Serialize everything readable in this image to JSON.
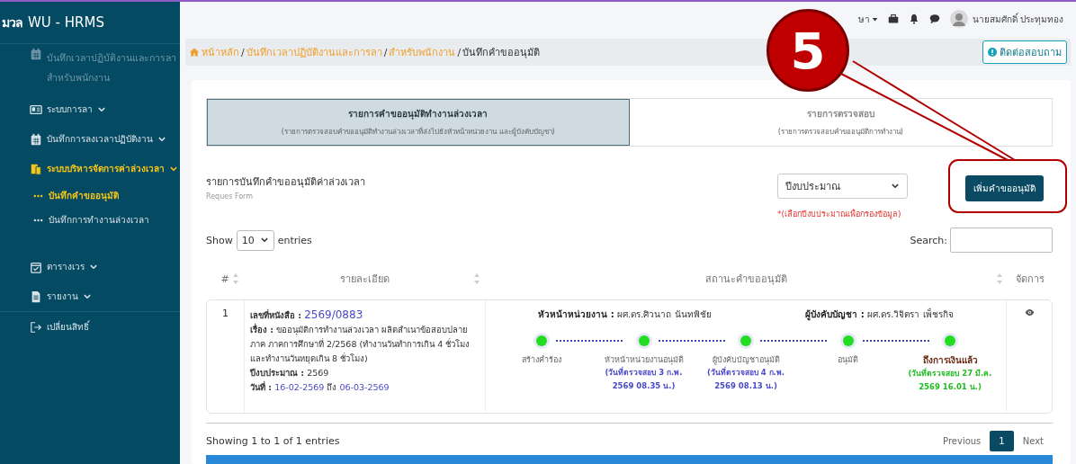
{
  "brand": {
    "logo": "มวล",
    "title": "WU - HRMS"
  },
  "sidebar": {
    "items": [
      {
        "label": "บันทึกเวลาปฏิบัติงานและการลา สำหรับพนักงาน",
        "kind": "header",
        "active": false
      },
      {
        "label": "ระบบการลา",
        "kind": "menu",
        "active": false
      },
      {
        "label": "บันทึกการลงเวลาปฏิบัติงาน",
        "kind": "menu",
        "active": false
      },
      {
        "label": "ระบบบริหารจัดการค่าล่วงเวลา",
        "kind": "menu",
        "active": true,
        "children": [
          {
            "label": "บันทึกคำขออนุมัติ",
            "selected": true
          },
          {
            "label": "บันทึกการทำงานล่วงเวลา",
            "selected": false
          }
        ]
      },
      {
        "label": "ตารางเวร",
        "kind": "menu",
        "active": false
      },
      {
        "label": "รายงาน",
        "kind": "menu",
        "active": false
      },
      {
        "label": "เปลี่ยนสิทธิ์",
        "kind": "link",
        "active": false
      }
    ]
  },
  "topbar": {
    "language": "ษา",
    "user": "นายสมศักดิ์ ประทุมทอง"
  },
  "breadcrumb_separator": "/",
  "breadcrumb": [
    "หน้าหลัก",
    "บันทึกเวลาปฏิบัติงานและการลา",
    "สำหรับพนักงาน",
    "บันทึกคำขออนุมัติ"
  ],
  "contact_button": "ติดต่อสอบถาม",
  "tabs": [
    {
      "title": "รายการคำขออนุมัติทำงานล่วงเวลา",
      "subtitle": "(รายการตรวจสอบคำขออนุมัติทำงานล่วงเวลาที่ส่งไปยังหัวหน้าหน่วยงาน และผู้บังคับบัญชา)",
      "selected": true
    },
    {
      "title": "รายการตรวจสอบ",
      "subtitle": "(รายการตรวจสอบคำขออนุมัติการทำงาน)",
      "selected": false
    }
  ],
  "list_header": {
    "title": "รายการบันทึกคำขออนุมัติค่าล่วงเวลา",
    "subtitle": "Reques Form"
  },
  "budget_select": {
    "value": "ปีงบประมาณ",
    "hint": "*(เลือกปีงบประมาณเพื่อกรองข้อมูล)"
  },
  "add_button": "เพิ่มคำขออนุมัติ",
  "length": {
    "show": "Show",
    "value": "10",
    "entries": "entries"
  },
  "search": {
    "label": "Search:"
  },
  "table": {
    "columns": [
      "#",
      "รายละเอียด",
      "สถานะคำขออนุมัติ",
      "จัดการ"
    ],
    "rows": [
      {
        "index": "1",
        "doc_no": {
          "label": "เลขที่หนังสือ :",
          "value": "2569/0883"
        },
        "subject": {
          "label": "เรื่อง :",
          "value": "ขออนุมัติการทำงานล่วงเวลา ผลิตสำเนาข้อสอบปลายภาค ภาคการศึกษาที่ 2/2568 (ทำงานวันทำการเกิน 4 ชั่วโมง และทำงานวันหยุดเกิน 8 ชั่วโมง)"
        },
        "budget_year": {
          "label": "ปีงบประมาณ :",
          "value": "2569"
        },
        "date": {
          "label": "วันที่ :",
          "from": "16-02-2569",
          "to_word": "ถึง",
          "to": "06-03-2569"
        },
        "approvers": [
          {
            "label": "หัวหน้าหน่วยงาน :",
            "name": "ผศ.ดร.ศิวนาถ นันทพิชัย"
          },
          {
            "label": "ผู้บังคับบัญชา :",
            "name": "ผศ.ดร.วิจิตรา เพ็ชรกิจ"
          }
        ],
        "steps": [
          {
            "label": "สร้างคำร้อง",
            "done": true,
            "final": false
          },
          {
            "label": "หัวหน้าหน่วยงานอนุมัติ",
            "date": "(วันที่ตรวจสอบ 3 ก.พ. 2569 08.35 น.)",
            "done": true,
            "final": false
          },
          {
            "label": "ผู้บังคับบัญชาอนุมัติ",
            "date": "(วันที่ตรวจสอบ 4 ก.พ. 2569 08.13 น.)",
            "done": true,
            "final": false
          },
          {
            "label": "อนุมัติ",
            "done": true,
            "final": false
          },
          {
            "label": "ถึงการเงินแล้ว",
            "date": "(วันที่ตรวจสอบ 27 มี.ค. 2569 16.01 น.)",
            "done": true,
            "final": true
          }
        ]
      }
    ]
  },
  "footer": {
    "info": "Showing 1 to 1 of 1 entries",
    "pages": [
      {
        "label": "Previous",
        "selected": false
      },
      {
        "label": "1",
        "selected": true
      },
      {
        "label": "Next",
        "selected": false
      }
    ]
  },
  "callout": {
    "number": "5"
  }
}
